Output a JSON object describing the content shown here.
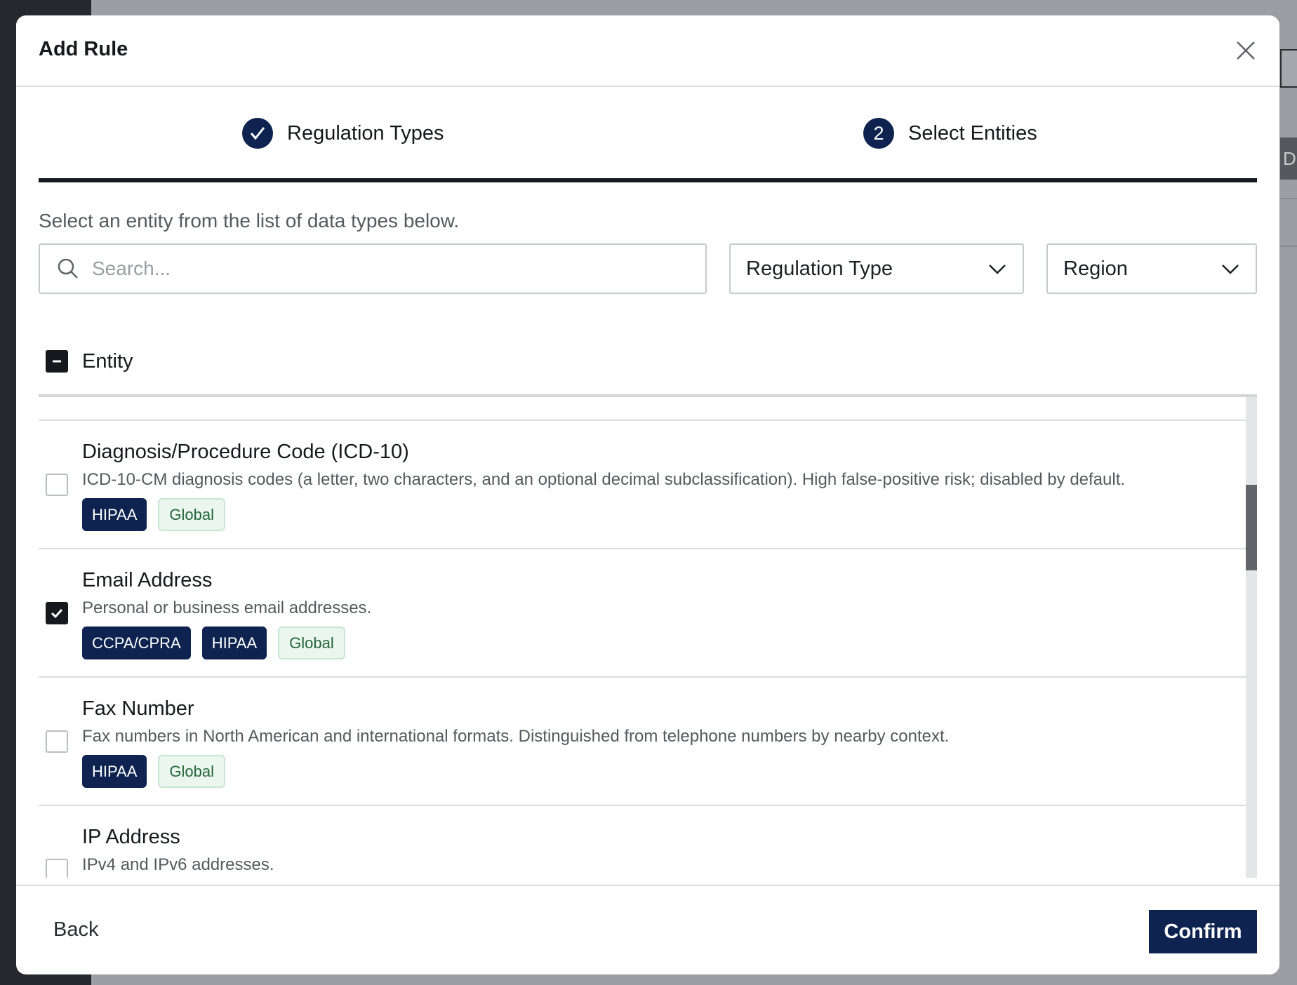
{
  "background": {
    "edge_letter": "D"
  },
  "modal": {
    "title": "Add Rule",
    "close_icon": "close-icon"
  },
  "stepper": {
    "steps": [
      {
        "label": "Regulation Types",
        "state": "complete",
        "icon": "check-icon"
      },
      {
        "number": "2",
        "label": "Select Entities",
        "state": "active"
      }
    ]
  },
  "instruction": "Select an entity from the list of data types below.",
  "search": {
    "placeholder": "Search...",
    "value": "",
    "icon": "search-icon"
  },
  "filters": {
    "regulation_type": {
      "label": "Regulation Type",
      "icon": "chevron-down-icon"
    },
    "region": {
      "label": "Region",
      "icon": "chevron-down-icon"
    }
  },
  "entity_header": {
    "label": "Entity",
    "select_all_state": "indeterminate"
  },
  "entities": [
    {
      "name": "Diagnosis/Procedure Code (ICD-10)",
      "description": "ICD-10-CM diagnosis codes (a letter, two characters, and an optional decimal subclassification). High false-positive risk; disabled by default.",
      "checked": false,
      "regulations": [
        "HIPAA"
      ],
      "region": "Global"
    },
    {
      "name": "Email Address",
      "description": "Personal or business email addresses.",
      "checked": true,
      "regulations": [
        "CCPA/CPRA",
        "HIPAA"
      ],
      "region": "Global"
    },
    {
      "name": "Fax Number",
      "description": "Fax numbers in North American and international formats. Distinguished from telephone numbers by nearby context.",
      "checked": false,
      "regulations": [
        "HIPAA"
      ],
      "region": "Global"
    },
    {
      "name": "IP Address",
      "description": "IPv4 and IPv6 addresses.",
      "checked": false,
      "regulations": [],
      "region": ""
    }
  ],
  "footer": {
    "back_label": "Back",
    "confirm_label": "Confirm"
  },
  "colors": {
    "primary_navy": "#0e2350",
    "region_tag_bg": "#eaf6ee",
    "region_tag_text": "#24653a",
    "overlay": "#9b9ea3"
  }
}
